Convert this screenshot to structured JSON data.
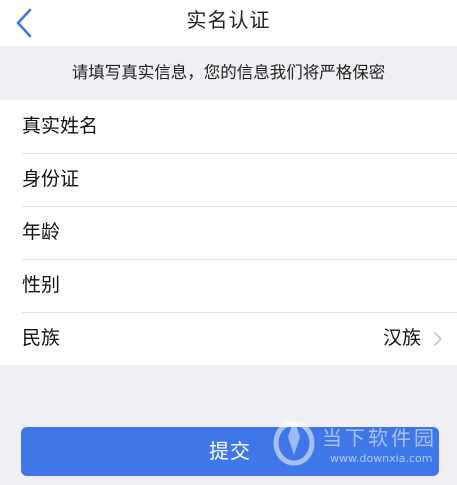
{
  "nav": {
    "title": "实名认证"
  },
  "notice": {
    "text": "请填写真实信息，您的信息我们将严格保密"
  },
  "form": {
    "rows": [
      {
        "label": "真实姓名",
        "value": ""
      },
      {
        "label": "身份证",
        "value": ""
      },
      {
        "label": "年龄",
        "value": ""
      },
      {
        "label": "性别",
        "value": ""
      },
      {
        "label": "民族",
        "value": "汉族"
      }
    ]
  },
  "submit": {
    "label": "提交"
  },
  "watermark": {
    "name": "当下软件园",
    "url": "www.downxia.com"
  },
  "colors": {
    "accent": "#3f77e8",
    "background": "#f0f0f4",
    "chevron": "#c7c7cc"
  },
  "icons": {
    "back": "chevron-left-icon",
    "row_disclosure": "chevron-right-icon"
  }
}
